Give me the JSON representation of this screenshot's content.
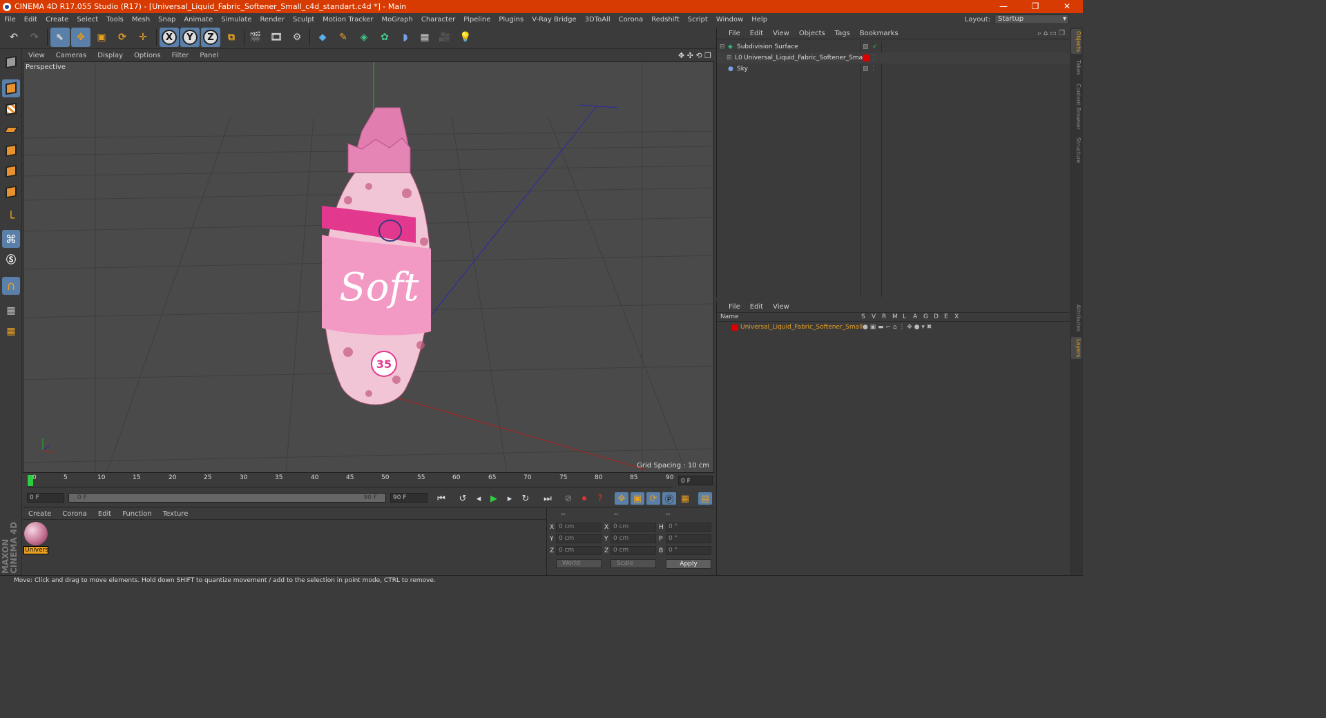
{
  "title": "CINEMA 4D R17.055 Studio (R17) - [Universal_Liquid_Fabric_Softener_Small_c4d_standart.c4d *] - Main",
  "window_buttons": [
    "—",
    "❐",
    "✕"
  ],
  "menu": [
    "File",
    "Edit",
    "Create",
    "Select",
    "Tools",
    "Mesh",
    "Snap",
    "Animate",
    "Simulate",
    "Render",
    "Sculpt",
    "Motion Tracker",
    "MoGraph",
    "Character",
    "Pipeline",
    "Plugins",
    "V-Ray Bridge",
    "3DToAll",
    "Corona",
    "Redshift",
    "Script",
    "Window",
    "Help"
  ],
  "layout": {
    "label": "Layout:",
    "value": "Startup"
  },
  "toolbar": {
    "x": "X",
    "y": "Y",
    "z": "Z"
  },
  "viewport": {
    "menu": [
      "View",
      "Cameras",
      "Display",
      "Options",
      "Filter",
      "Panel"
    ],
    "label": "Perspective",
    "grid_spacing": "Grid Spacing : 10 cm",
    "model_text": "Soft",
    "badge": "35"
  },
  "timeline": {
    "ticks": [
      "0",
      "5",
      "10",
      "15",
      "20",
      "25",
      "30",
      "35",
      "40",
      "45",
      "50",
      "55",
      "60",
      "65",
      "70",
      "75",
      "80",
      "85",
      "90"
    ],
    "current": "0 F",
    "start": "0 F",
    "range_start": "0 F",
    "range_end": "90 F",
    "end": "90 F"
  },
  "material_manager": {
    "menu": [
      "Create",
      "Corona",
      "Edit",
      "Function",
      "Texture"
    ],
    "material_name": "Univers"
  },
  "coords": {
    "headers": [
      "--",
      "--",
      "--"
    ],
    "rows": [
      {
        "a": "X",
        "av": "0 cm",
        "b": "X",
        "bv": "0 cm",
        "c": "H",
        "cv": "0 °"
      },
      {
        "a": "Y",
        "av": "0 cm",
        "b": "Y",
        "bv": "0 cm",
        "c": "P",
        "cv": "0 °"
      },
      {
        "a": "Z",
        "av": "0 cm",
        "b": "Z",
        "bv": "0 cm",
        "c": "B",
        "cv": "0 °"
      }
    ],
    "mode": "World",
    "scale": "Scale",
    "apply": "Apply"
  },
  "status": "Move: Click and drag to move elements. Hold down SHIFT to quantize movement / add to the selection in point mode, CTRL to remove.",
  "object_manager": {
    "menu": [
      "File",
      "Edit",
      "View",
      "Objects",
      "Tags",
      "Bookmarks"
    ],
    "objects": [
      "Subdivision Surface",
      "Universal_Liquid_Fabric_Softener_Small",
      "Sky"
    ]
  },
  "layer_manager": {
    "menu": [
      "File",
      "Edit",
      "View"
    ],
    "columns": [
      "Name",
      "S",
      "V",
      "R",
      "M",
      "L",
      "A",
      "G",
      "D",
      "E",
      "X"
    ],
    "layer": "Universal_Liquid_Fabric_Softener_Small"
  },
  "right_tabs": [
    "Objects",
    "Takes",
    "Content Browser",
    "Structure",
    "Attributes",
    "Layers"
  ],
  "maxon": "MAXON CINEMA 4D",
  "colors": {
    "titlebar": "#d83b01",
    "accent": "#5a7fa8",
    "layer": "#e8a020"
  }
}
